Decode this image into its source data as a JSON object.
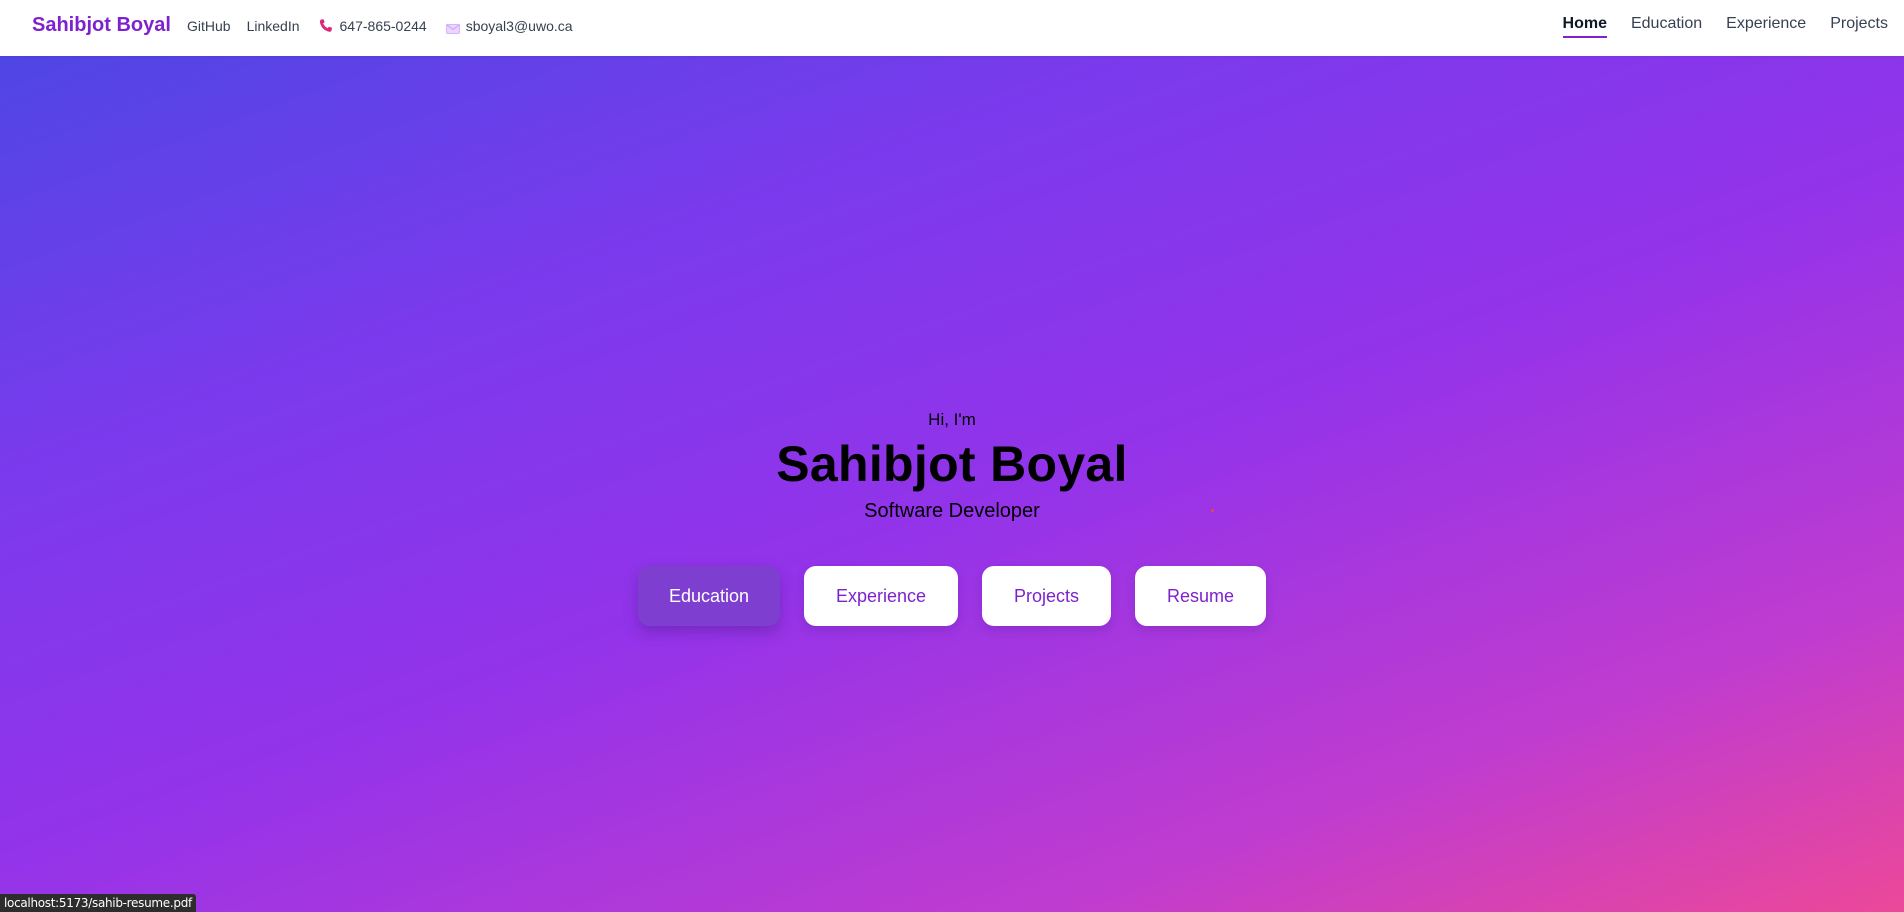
{
  "navbar": {
    "brand": "Sahibjot Boyal",
    "github_label": "GitHub",
    "linkedin_label": "LinkedIn",
    "phone": "647-865-0244",
    "phone_icon": "phone-icon",
    "email": "sboyal3@uwo.ca",
    "email_icon": "mail-icon",
    "nav_items": [
      {
        "label": "Home",
        "active": true
      },
      {
        "label": "Education",
        "active": false
      },
      {
        "label": "Experience",
        "active": false
      },
      {
        "label": "Projects",
        "active": false
      }
    ],
    "accent_color": "#7e22ce"
  },
  "hero": {
    "greeting": "Hi, I'm",
    "name": "Sahibjot Boyal",
    "role": "Software Developer",
    "buttons": [
      {
        "label": "Education",
        "style": "primary"
      },
      {
        "label": "Experience",
        "style": "secondary"
      },
      {
        "label": "Projects",
        "style": "secondary"
      },
      {
        "label": "Resume",
        "style": "secondary"
      }
    ],
    "gradient_colors": [
      "#4f46e5",
      "#9333ea",
      "#ec4899"
    ]
  },
  "status_bar": {
    "url": "localhost:5173/sahib-resume.pdf"
  }
}
